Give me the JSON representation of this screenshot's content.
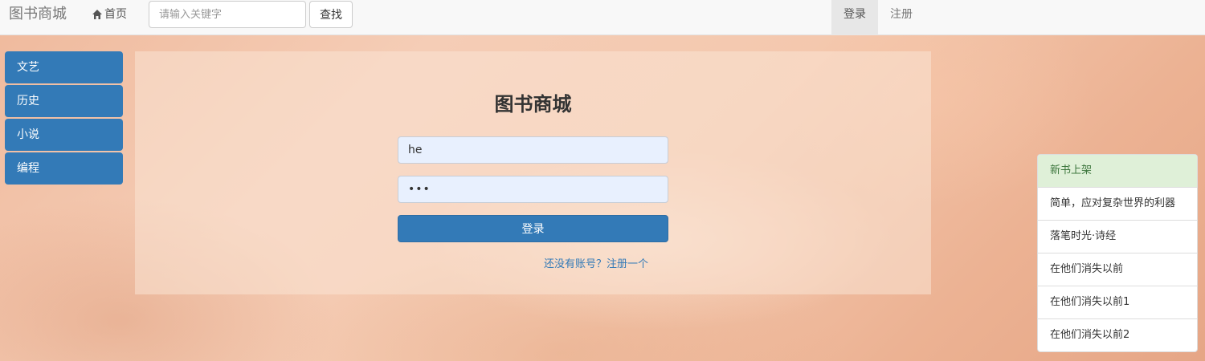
{
  "navbar": {
    "brand": "图书商城",
    "home_label": "首页",
    "search_placeholder": "请输入关键字",
    "search_button": "查找",
    "login_label": "登录",
    "register_label": "注册"
  },
  "categories": [
    {
      "label": "文艺"
    },
    {
      "label": "历史"
    },
    {
      "label": "小说"
    },
    {
      "label": "编程"
    }
  ],
  "login": {
    "title": "图书商城",
    "username_value": "he",
    "password_value": "•••",
    "submit_label": "登录",
    "register_link": "还没有账号？注册一个"
  },
  "new_books": {
    "header": "新书上架",
    "items": [
      {
        "label": "简单，应对复杂世界的利器"
      },
      {
        "label": "落笔时光·诗经"
      },
      {
        "label": "在他们消失以前"
      },
      {
        "label": "在他们消失以前1"
      },
      {
        "label": "在他们消失以前2"
      }
    ]
  },
  "colors": {
    "primary": "#337ab7",
    "navbar_bg": "#f8f8f8",
    "success_bg": "#dff0d8",
    "success_text": "#3c763d"
  }
}
